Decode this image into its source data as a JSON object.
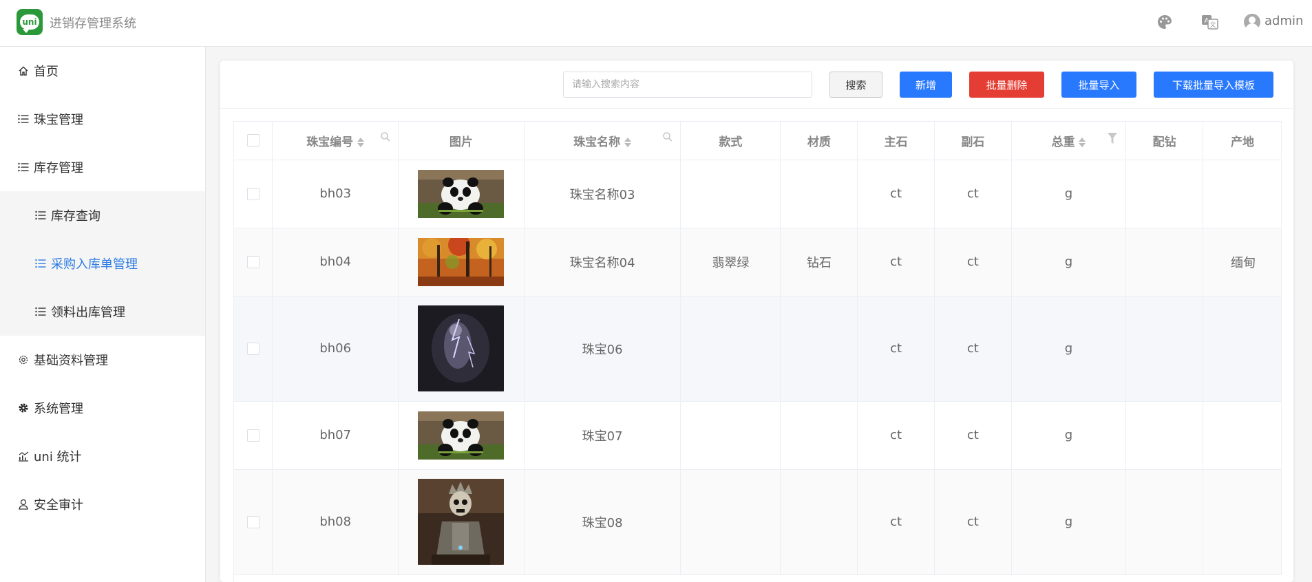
{
  "app": {
    "logo_text": "uni",
    "title": "进销存管理系统"
  },
  "header": {
    "theme_icon": "palette-icon",
    "lang_icon": "translate-icon",
    "user_icon": "user-icon",
    "username": "admin"
  },
  "sidebar": {
    "items": [
      {
        "label": "首页",
        "icon": "home-icon"
      },
      {
        "label": "珠宝管理",
        "icon": "list-icon"
      },
      {
        "label": "库存管理",
        "icon": "list-icon"
      },
      {
        "label": "库存查询",
        "icon": "list-icon"
      },
      {
        "label": "采购入库单管理",
        "icon": "list-icon",
        "active": true
      },
      {
        "label": "领料出库管理",
        "icon": "list-icon"
      },
      {
        "label": "基础资料管理",
        "icon": "gear-outline-icon"
      },
      {
        "label": "系统管理",
        "icon": "gear-icon"
      },
      {
        "label": "uni 统计",
        "icon": "chart-icon"
      },
      {
        "label": "安全审计",
        "icon": "person-icon"
      }
    ]
  },
  "toolbar": {
    "search_placeholder": "请输入搜索内容",
    "search_button": "搜索",
    "add_button": "新增",
    "batch_delete_button": "批量删除",
    "batch_import_button": "批量导入",
    "download_template_button": "下载批量导入模板"
  },
  "table": {
    "columns": [
      "珠宝编号",
      "图片",
      "珠宝名称",
      "款式",
      "材质",
      "主石",
      "副石",
      "总重",
      "配钻",
      "产地"
    ],
    "rows": [
      {
        "code": "bh03",
        "image": "panda",
        "name": "珠宝名称03",
        "style": "",
        "material": "",
        "main_stone": "ct",
        "side_stone": "ct",
        "weight": "g",
        "diamond": "",
        "origin": ""
      },
      {
        "code": "bh04",
        "image": "autumn-forest",
        "name": "珠宝名称04",
        "style": "翡翠绿",
        "material": "钻石",
        "main_stone": "ct",
        "side_stone": "ct",
        "weight": "g",
        "diamond": "",
        "origin": "缅甸"
      },
      {
        "code": "bh06",
        "image": "storm-figure",
        "name": "珠宝06",
        "style": "",
        "material": "",
        "main_stone": "ct",
        "side_stone": "ct",
        "weight": "g",
        "diamond": "",
        "origin": ""
      },
      {
        "code": "bh07",
        "image": "panda",
        "name": "珠宝07",
        "style": "",
        "material": "",
        "main_stone": "ct",
        "side_stone": "ct",
        "weight": "g",
        "diamond": "",
        "origin": ""
      },
      {
        "code": "bh08",
        "image": "skeleton-king",
        "name": "珠宝08",
        "style": "",
        "material": "",
        "main_stone": "ct",
        "side_stone": "ct",
        "weight": "g",
        "diamond": "",
        "origin": ""
      }
    ]
  },
  "colors": {
    "primary": "#2979ff",
    "danger": "#e43d33",
    "active_menu": "#2b7be3",
    "logo_green": "#2b9939"
  }
}
